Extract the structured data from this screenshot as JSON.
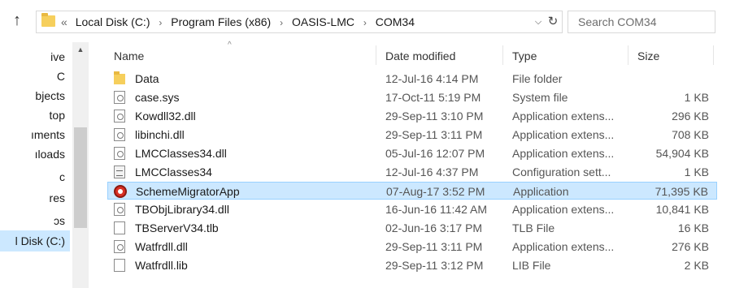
{
  "address": {
    "lead": "«",
    "crumbs": [
      "Local Disk (C:)",
      "Program Files (x86)",
      "OASIS-LMC",
      "COM34"
    ],
    "separator": "›"
  },
  "search": {
    "placeholder": "Search COM34"
  },
  "nav": {
    "items": [
      {
        "label": "ive",
        "selected": false
      },
      {
        "label": "C",
        "selected": false
      },
      {
        "label": "bjects",
        "selected": false
      },
      {
        "label": "top",
        "selected": false
      },
      {
        "label": "ıments",
        "selected": false
      },
      {
        "label": "ıloads",
        "selected": false
      },
      {
        "label": "c",
        "selected": false
      },
      {
        "label": "res",
        "selected": false
      },
      {
        "label": "ɔs",
        "selected": false
      },
      {
        "label": "l Disk (C:)",
        "selected": true
      }
    ]
  },
  "columns": {
    "name": "Name",
    "date": "Date modified",
    "type": "Type",
    "size": "Size"
  },
  "files": [
    {
      "name": "Data",
      "date": "12-Jul-16 4:14 PM",
      "type": "File folder",
      "size": "",
      "icon": "folder-icon",
      "selected": false
    },
    {
      "name": "case.sys",
      "date": "17-Oct-11 5:19 PM",
      "type": "System file",
      "size": "1 KB",
      "icon": "system-file-icon",
      "selected": false
    },
    {
      "name": "Kowdll32.dll",
      "date": "29-Sep-11 3:10 PM",
      "type": "Application extens...",
      "size": "296 KB",
      "icon": "dll-file-icon",
      "selected": false
    },
    {
      "name": "libinchi.dll",
      "date": "29-Sep-11 3:11 PM",
      "type": "Application extens...",
      "size": "708 KB",
      "icon": "dll-file-icon",
      "selected": false
    },
    {
      "name": "LMCClasses34.dll",
      "date": "05-Jul-16 12:07 PM",
      "type": "Application extens...",
      "size": "54,904 KB",
      "icon": "dll-file-icon",
      "selected": false
    },
    {
      "name": "LMCClasses34",
      "date": "12-Jul-16 4:37 PM",
      "type": "Configuration sett...",
      "size": "1 KB",
      "icon": "config-file-icon",
      "selected": false
    },
    {
      "name": "SchemeMigratorApp",
      "date": "07-Aug-17 3:52 PM",
      "type": "Application",
      "size": "71,395 KB",
      "icon": "application-icon",
      "selected": true
    },
    {
      "name": "TBObjLibrary34.dll",
      "date": "16-Jun-16 11:42 AM",
      "type": "Application extens...",
      "size": "10,841 KB",
      "icon": "dll-file-icon",
      "selected": false
    },
    {
      "name": "TBServerV34.tlb",
      "date": "02-Jun-16 3:17 PM",
      "type": "TLB File",
      "size": "16 KB",
      "icon": "blank-file-icon",
      "selected": false
    },
    {
      "name": "Watfrdll.dll",
      "date": "29-Sep-11 3:11 PM",
      "type": "Application extens...",
      "size": "276 KB",
      "icon": "dll-file-icon",
      "selected": false
    },
    {
      "name": "Watfrdll.lib",
      "date": "29-Sep-11 3:12 PM",
      "type": "LIB File",
      "size": "2 KB",
      "icon": "blank-file-icon",
      "selected": false
    }
  ],
  "colors": {
    "selection": "#cce8ff",
    "selection_border": "#99d1ff",
    "folder": "#f6cf5c"
  }
}
